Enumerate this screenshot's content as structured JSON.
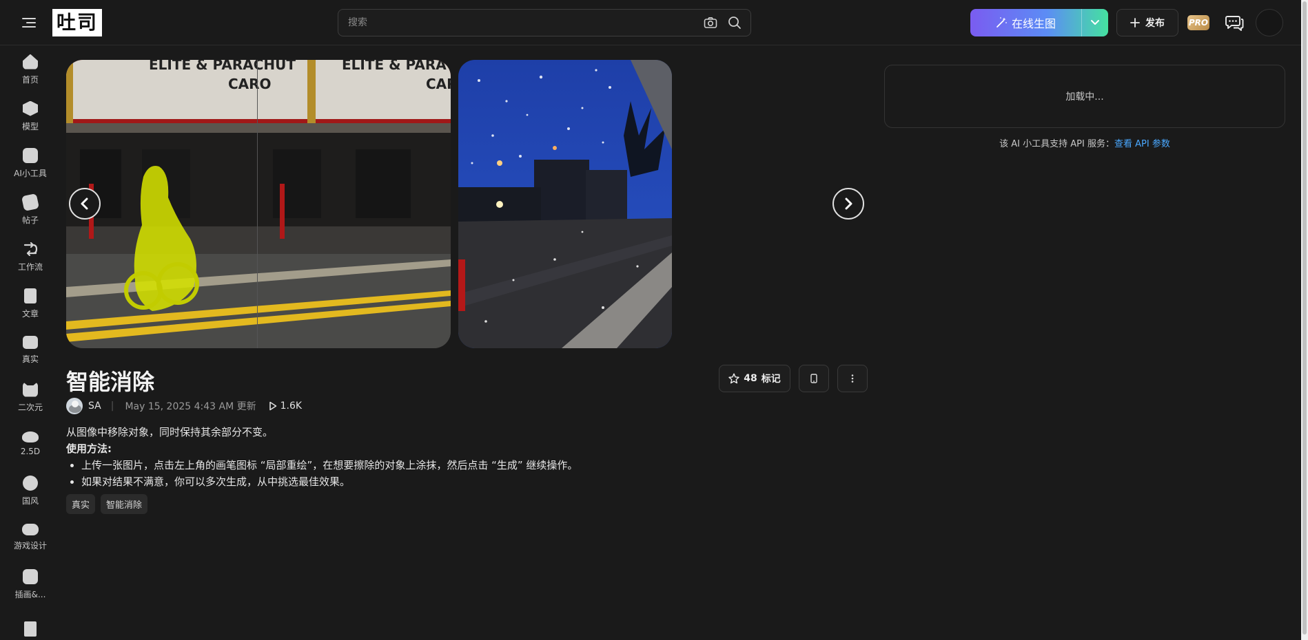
{
  "header": {
    "logo_text": "吐司",
    "search_placeholder": "搜索",
    "generate_label": "在线生图",
    "publish_label": "发布",
    "pro_label": "PRO"
  },
  "sidebar": {
    "items": [
      {
        "label": "首页",
        "icon": "home-icon"
      },
      {
        "label": "模型",
        "icon": "cube-icon"
      },
      {
        "label": "AI小工具",
        "icon": "tool-icon"
      },
      {
        "label": "帖子",
        "icon": "post-icon"
      },
      {
        "label": "工作流",
        "icon": "workflow-icon"
      },
      {
        "label": "文章",
        "icon": "article-icon"
      },
      {
        "label": "真实",
        "icon": "camera-icon"
      },
      {
        "label": "二次元",
        "icon": "cat-icon"
      },
      {
        "label": "2.5D",
        "icon": "ufo-icon"
      },
      {
        "label": "国风",
        "icon": "palette-icon"
      },
      {
        "label": "游戏设计",
        "icon": "gamepad-icon"
      },
      {
        "label": "插画&...",
        "icon": "illustration-icon"
      },
      {
        "label": "",
        "icon": "pillar-icon"
      }
    ]
  },
  "post": {
    "title": "智能消除",
    "author": "SA",
    "date": "May 15, 2025 4:43 AM 更新",
    "views": "1.6K",
    "star_count": "48",
    "star_label": "标记",
    "description": "从图像中移除对象，同时保持其余部分不变。",
    "howto_title": "使用方法:",
    "steps": [
      "上传一张图片，点击左上角的画笔图标 “局部重绘”，在想要擦除的对象上涂抹，然后点击 “生成” 继续操作。",
      "如果对结果不满意，你可以多次生成，从中挑选最佳效果。"
    ],
    "tags": [
      "真实",
      "智能消除"
    ]
  },
  "panel": {
    "loading_text": "加载中...",
    "api_text": "该 AI 小工具支持 API 服务：",
    "api_link": "查看 API 参数"
  },
  "colors": {
    "background": "#1a1a1a",
    "accent_start": "#7a5cf0",
    "accent_end": "#45e1a0",
    "link": "#4aa8ff",
    "pro_gold": "#c9a05a"
  }
}
